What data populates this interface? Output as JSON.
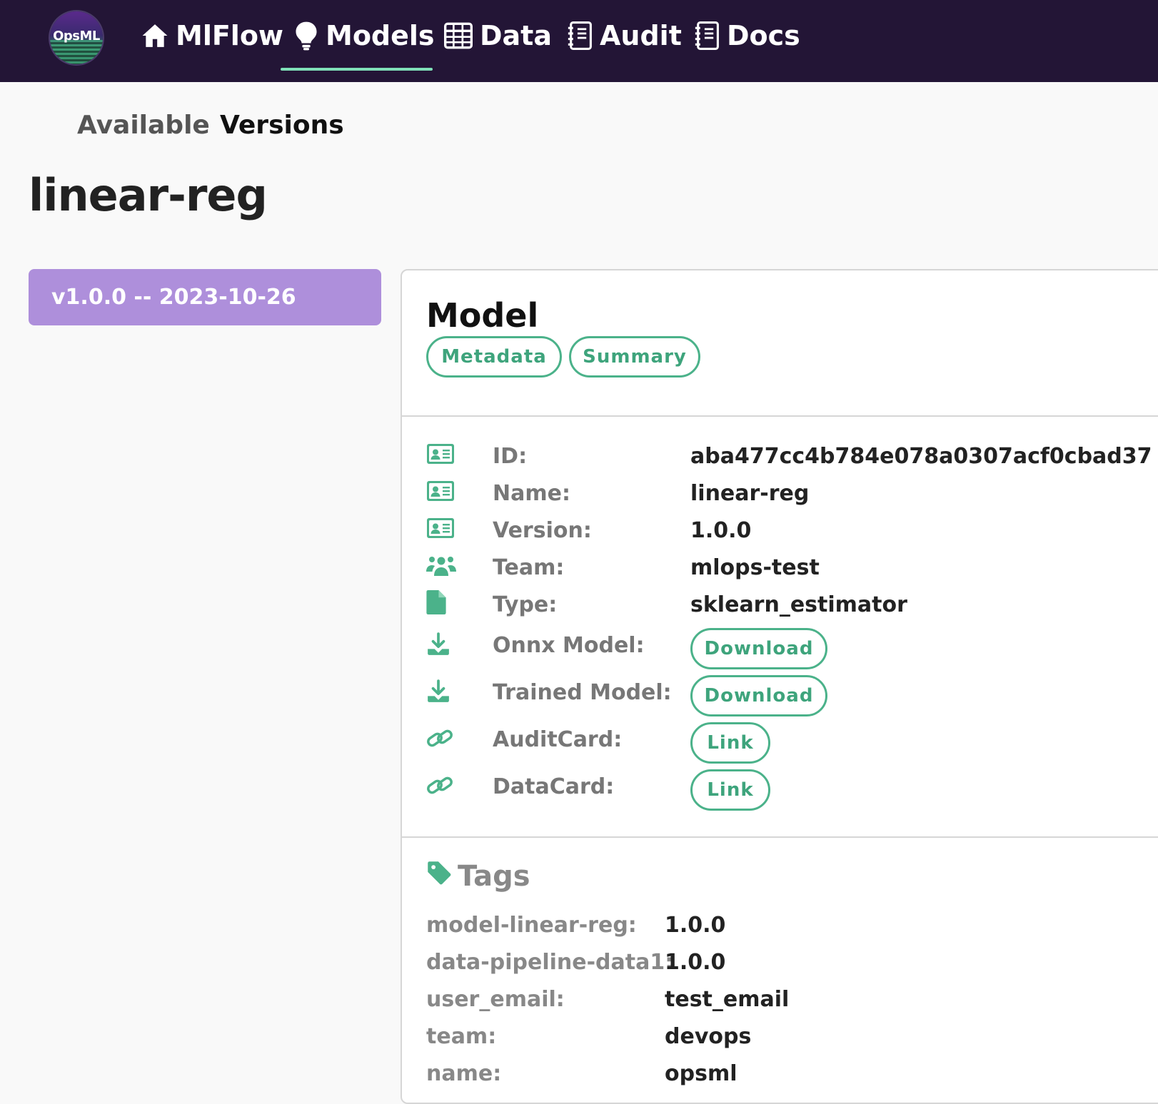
{
  "nav": {
    "logo_text": "OpsML",
    "items": [
      {
        "label": "MlFlow",
        "icon": "home-icon"
      },
      {
        "label": "Models",
        "icon": "lightbulb-icon"
      },
      {
        "label": "Data",
        "icon": "table-icon"
      },
      {
        "label": "Audit",
        "icon": "notebook-icon"
      },
      {
        "label": "Docs",
        "icon": "notebook-icon"
      }
    ],
    "active": "Models"
  },
  "subtabs": {
    "available": "Available",
    "versions": "Versions",
    "active": "Versions"
  },
  "page_title": "linear-reg",
  "versions": [
    {
      "label": "v1.0.0 -- 2023-10-26"
    }
  ],
  "card": {
    "title": "Model",
    "buttons": {
      "metadata": "Metadata",
      "summary": "Summary"
    },
    "fields": [
      {
        "icon": "id-card-icon",
        "label": "ID:",
        "value": "aba477cc4b784e078a0307acf0cbad37"
      },
      {
        "icon": "id-card-icon",
        "label": "Name:",
        "value": "linear-reg"
      },
      {
        "icon": "id-card-icon",
        "label": "Version:",
        "value": "1.0.0"
      },
      {
        "icon": "users-icon",
        "label": "Team:",
        "value": "mlops-test"
      },
      {
        "icon": "file-icon",
        "label": "Type:",
        "value": "sklearn_estimator"
      },
      {
        "icon": "download-icon",
        "label": "Onnx Model:",
        "button": "Download"
      },
      {
        "icon": "download-icon",
        "label": "Trained Model:",
        "button": "Download"
      },
      {
        "icon": "link-icon",
        "label": "AuditCard:",
        "button": "Link"
      },
      {
        "icon": "link-icon",
        "label": "DataCard:",
        "button": "Link"
      }
    ],
    "tags_title": "Tags",
    "tags": [
      {
        "key": "model-linear-reg:",
        "value": "1.0.0"
      },
      {
        "key": "data-pipeline-data1:",
        "value": "1.0.0"
      },
      {
        "key": "user_email:",
        "value": "test_email"
      },
      {
        "key": "team:",
        "value": "devops"
      },
      {
        "key": "name:",
        "value": "opsml"
      }
    ]
  },
  "colors": {
    "nav_bg": "#231536",
    "accent_green": "#4bb28a",
    "version_pill": "#ae8fdb",
    "nav_underline": "#7fe0b8"
  }
}
